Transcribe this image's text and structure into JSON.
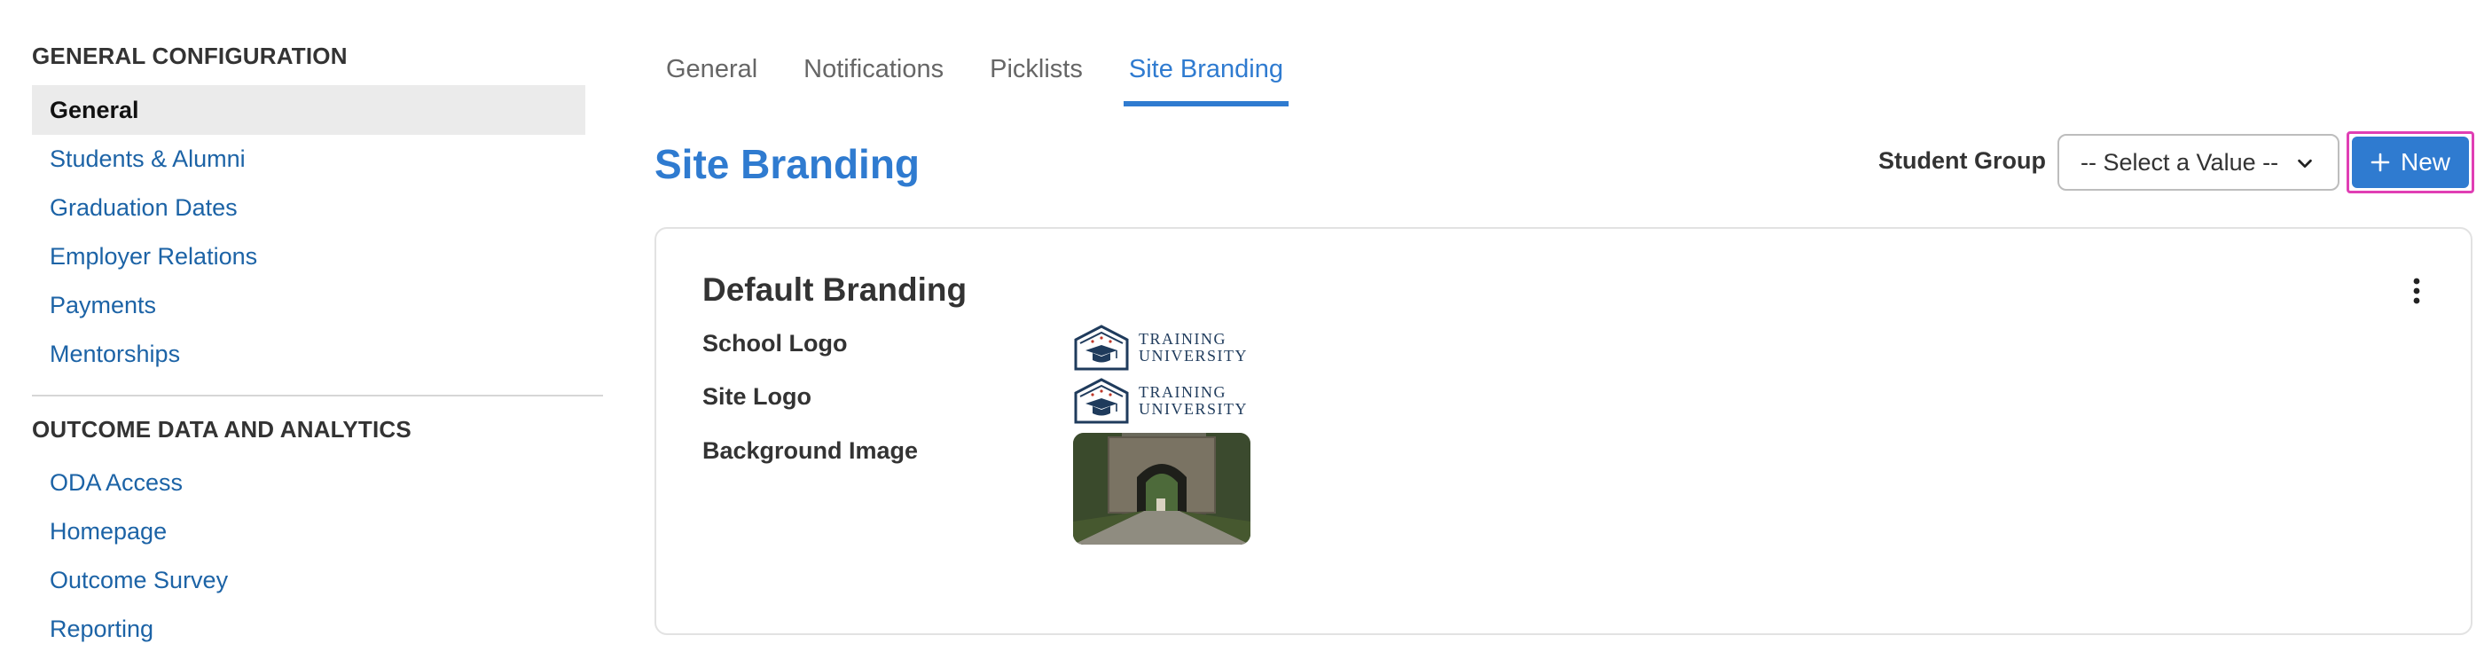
{
  "sidebar": {
    "sections": [
      {
        "heading": "GENERAL CONFIGURATION",
        "items": [
          {
            "label": "General",
            "active": true
          },
          {
            "label": "Students & Alumni"
          },
          {
            "label": "Graduation Dates"
          },
          {
            "label": "Employer Relations"
          },
          {
            "label": "Payments"
          },
          {
            "label": "Mentorships"
          }
        ]
      },
      {
        "heading": "OUTCOME DATA AND ANALYTICS",
        "items": [
          {
            "label": "ODA Access"
          },
          {
            "label": "Homepage"
          },
          {
            "label": "Outcome Survey"
          },
          {
            "label": "Reporting"
          }
        ]
      }
    ]
  },
  "tabs": [
    {
      "label": "General"
    },
    {
      "label": "Notifications"
    },
    {
      "label": "Picklists"
    },
    {
      "label": "Site Branding",
      "active": true
    }
  ],
  "page": {
    "title": "Site Branding",
    "filter_label": "Student Group",
    "select_value": "-- Select a Value --",
    "new_button": "New"
  },
  "card": {
    "title": "Default Branding",
    "rows": [
      {
        "label": "School Logo",
        "logo_line1": "TRAINING",
        "logo_line2": "UNIVERSITY"
      },
      {
        "label": "Site Logo",
        "logo_line1": "TRAINING",
        "logo_line2": "UNIVERSITY"
      },
      {
        "label": "Background Image"
      }
    ]
  },
  "colors": {
    "accent": "#2f7bd0",
    "link": "#1c63a6",
    "highlight_outline": "#e03fb4",
    "active_bg": "#ebebeb"
  },
  "icons": {
    "select": "chevron-down-icon",
    "new": "plus-icon",
    "menu": "kebab-menu-icon",
    "logo": "graduation-cap-icon"
  }
}
